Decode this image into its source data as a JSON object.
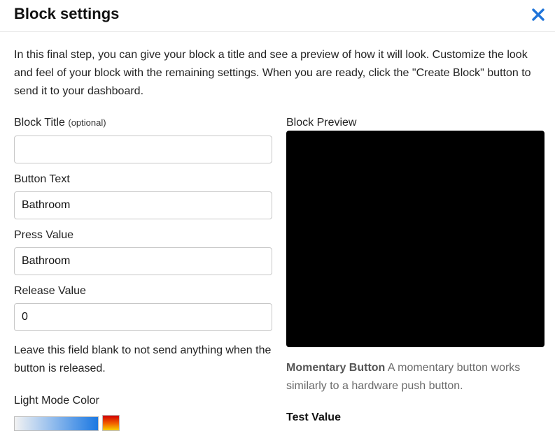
{
  "modal": {
    "title": "Block settings",
    "close_icon": "close-icon",
    "accent_color": "#1f74d9"
  },
  "intro": {
    "text": "In this final step, you can give your block a title and see a preview of how it will look. Customize the look and feel of your block with the remaining settings. When you are ready, click the \"Create Block\" button to send it to your dashboard."
  },
  "form": {
    "block_title": {
      "label": "Block Title",
      "optional": "(optional)",
      "value": ""
    },
    "button_text": {
      "label": "Button Text",
      "value": "Bathroom"
    },
    "press_value": {
      "label": "Press Value",
      "value": "Bathroom"
    },
    "release_value": {
      "label": "Release Value",
      "value": "0"
    },
    "release_help": "Leave this field blank to not send anything when the button is released.",
    "light_mode_color": {
      "label": "Light Mode Color"
    }
  },
  "preview": {
    "label": "Block Preview",
    "background": "#000000",
    "type_name": "Momentary Button",
    "type_desc": "A momentary button works similarly to a hardware push button.",
    "test_value_title": "Test Value"
  }
}
